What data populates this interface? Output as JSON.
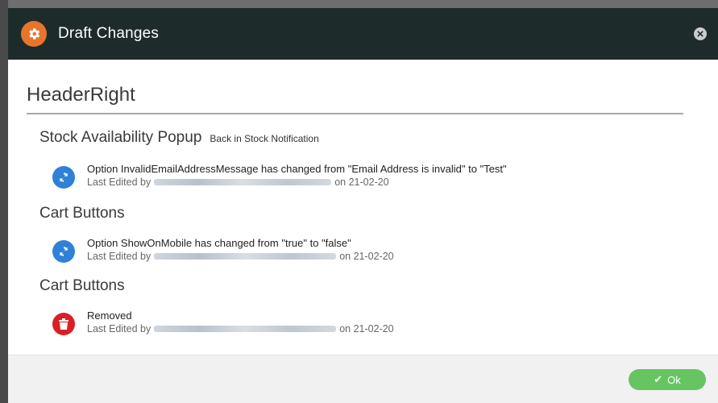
{
  "dialog": {
    "title": "Draft Changes",
    "icon": "gear-icon",
    "close_icon": "close-icon",
    "accent_color": "#e8752b",
    "header_color": "#1d2c2b"
  },
  "component": {
    "name": "HeaderRight"
  },
  "sections": [
    {
      "title": "Stock Availability Popup",
      "subtitle": "Back in Stock Notification",
      "change": {
        "icon": "refresh-icon",
        "icon_color": "#2f80d8",
        "description": "Option InvalidEmailAddressMessage has changed from \"Email Address is invalid\" to \"Test\"",
        "edited_prefix": "Last Edited by",
        "edited_suffix": "on 21-02-20"
      }
    },
    {
      "title": "Cart Buttons",
      "change": {
        "icon": "refresh-icon",
        "icon_color": "#2f80d8",
        "description": "Option ShowOnMobile has changed from \"true\" to \"false\"",
        "edited_prefix": "Last Edited by",
        "edited_suffix": "on 21-02-20"
      }
    },
    {
      "title": "Cart Buttons",
      "change": {
        "icon": "trash-icon",
        "icon_color": "#db1f24",
        "description": "Removed",
        "edited_prefix": "Last Edited by",
        "edited_suffix": "on 21-02-20"
      }
    }
  ],
  "footer": {
    "ok_label": "Ok",
    "ok_color": "#67c561"
  }
}
